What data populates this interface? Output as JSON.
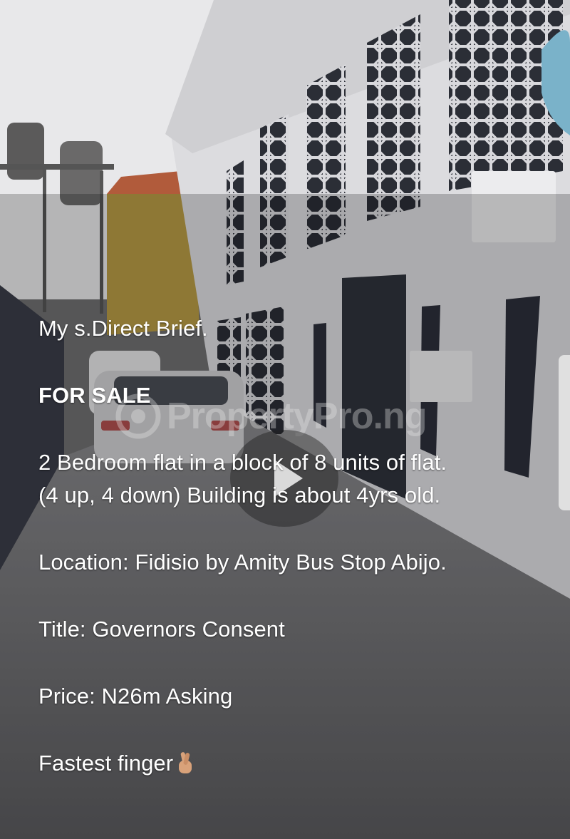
{
  "caption": {
    "line1": "My s.Direct Brief.",
    "line2": "FOR SALE",
    "line3": "2 Bedroom flat in a block of 8 units of flat.",
    "line4": "(4 up, 4 down) Building is about 4yrs old.",
    "line5": "Location:  Fidisio by Amity Bus Stop Abijo.",
    "line6": "Title: Governors Consent",
    "line7": "Price: N26m Asking",
    "line8": "Fastest finger",
    "emoji_icon": "crossed-fingers-icon"
  },
  "watermark": {
    "text": "PropertyPro.ng"
  },
  "video": {
    "play_icon": "play-icon"
  },
  "colors": {
    "text": "#ffffff",
    "overlay": "rgba(0,0,0,0.22)",
    "sky": "#e9e9ea",
    "wall": "#d9d9dc",
    "ground": "#5d5d5f"
  }
}
